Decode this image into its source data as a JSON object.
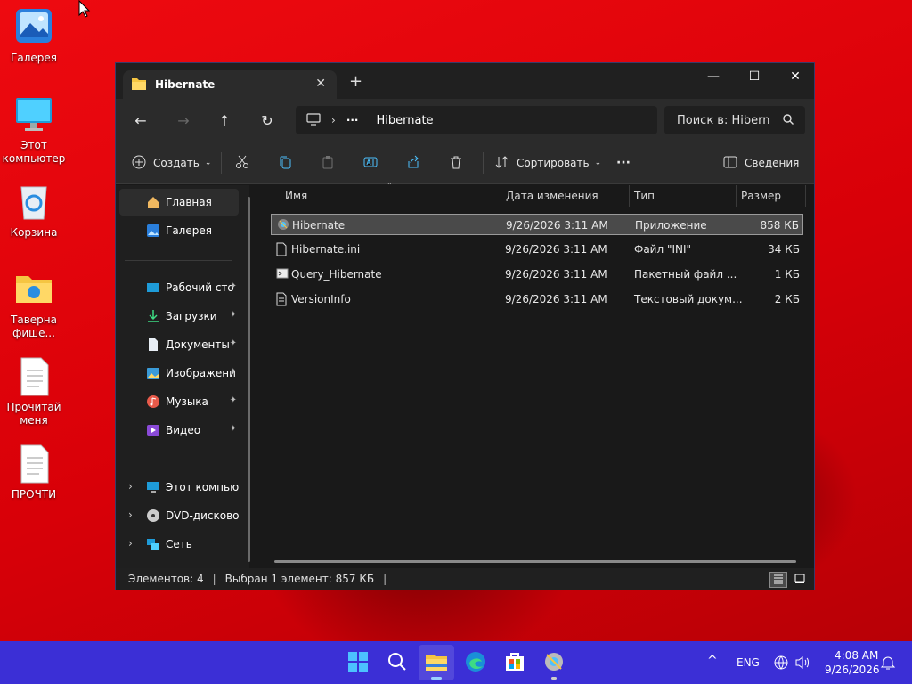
{
  "desktop": {
    "icons": [
      {
        "label": "Галерея",
        "icon": "gallery-icon"
      },
      {
        "label": "Этот компьютер",
        "icon": "computer-icon"
      },
      {
        "label": "Корзина",
        "icon": "recycle-bin-icon"
      },
      {
        "label": "Таверна фише...",
        "icon": "folder-icon"
      },
      {
        "label": "Прочитай меня",
        "icon": "document-icon"
      },
      {
        "label": "ПРОЧТИ",
        "icon": "document-icon"
      }
    ]
  },
  "window": {
    "tab_title": "Hibernate",
    "tab_close": "✕",
    "new_tab": "+",
    "controls": {
      "minimize": "—",
      "maximize": "☐",
      "close": "✕"
    },
    "nav": {
      "back": "←",
      "forward": "→",
      "up": "↑",
      "refresh": "↻"
    },
    "address": {
      "more": "···",
      "crumb": "Hibernate",
      "chevron": "›"
    },
    "search_placeholder": "Поиск в: Hibern",
    "command_bar": {
      "create": "Создать",
      "sort": "Сортировать",
      "more": "···",
      "details": "Сведения"
    },
    "sidebar": {
      "quick": [
        {
          "label": "Главная",
          "icon": "home-icon",
          "selected": true
        },
        {
          "label": "Галерея",
          "icon": "gallery-icon",
          "selected": false
        }
      ],
      "pinned": [
        {
          "label": "Рабочий сто",
          "icon": "desktop-icon"
        },
        {
          "label": "Загрузки",
          "icon": "download-icon"
        },
        {
          "label": "Документы",
          "icon": "documents-icon"
        },
        {
          "label": "Изображени",
          "icon": "pictures-icon"
        },
        {
          "label": "Музыка",
          "icon": "music-icon"
        },
        {
          "label": "Видео",
          "icon": "video-icon"
        }
      ],
      "devices": [
        {
          "label": "Этот компьюте",
          "icon": "computer-icon"
        },
        {
          "label": "DVD-дисковод (",
          "icon": "dvd-icon"
        },
        {
          "label": "Сеть",
          "icon": "network-icon"
        }
      ],
      "pin_glyph": "📌",
      "expand_glyph": "›"
    },
    "columns": [
      "Имя",
      "Дата изменения",
      "Тип",
      "Размер"
    ],
    "files": [
      {
        "name": "Hibernate",
        "date": "9/26/2026 3:11 AM",
        "type": "Приложение",
        "size": "858 КБ",
        "icon": "application-icon",
        "selected": true
      },
      {
        "name": "Hibernate.ini",
        "date": "9/26/2026 3:11 AM",
        "type": "Файл \"INI\"",
        "size": "34 КБ",
        "icon": "ini-file-icon",
        "selected": false
      },
      {
        "name": "Query_Hibernate",
        "date": "9/26/2026 3:11 AM",
        "type": "Пакетный файл ...",
        "size": "1 КБ",
        "icon": "batch-file-icon",
        "selected": false
      },
      {
        "name": "VersionInfo",
        "date": "9/26/2026 3:11 AM",
        "type": "Текстовый докум...",
        "size": "2 КБ",
        "icon": "text-file-icon",
        "selected": false
      }
    ],
    "status": {
      "count": "Элементов: 4",
      "selected": "Выбран 1 элемент: 857 КБ",
      "sep": "|"
    }
  },
  "taskbar": {
    "apps": [
      "start-icon",
      "search-icon",
      "file-explorer-icon",
      "edge-icon",
      "store-icon",
      "hibernate-app-icon"
    ],
    "tray": {
      "chevron": "^",
      "language": "ENG",
      "time": "4:08 AM",
      "date": "9/26/2026"
    }
  },
  "colors": {
    "wallpaper": "#e0000a",
    "taskbar": "#3b2fd6",
    "window_bg": "#191919",
    "accent": "#4cc2ff"
  }
}
